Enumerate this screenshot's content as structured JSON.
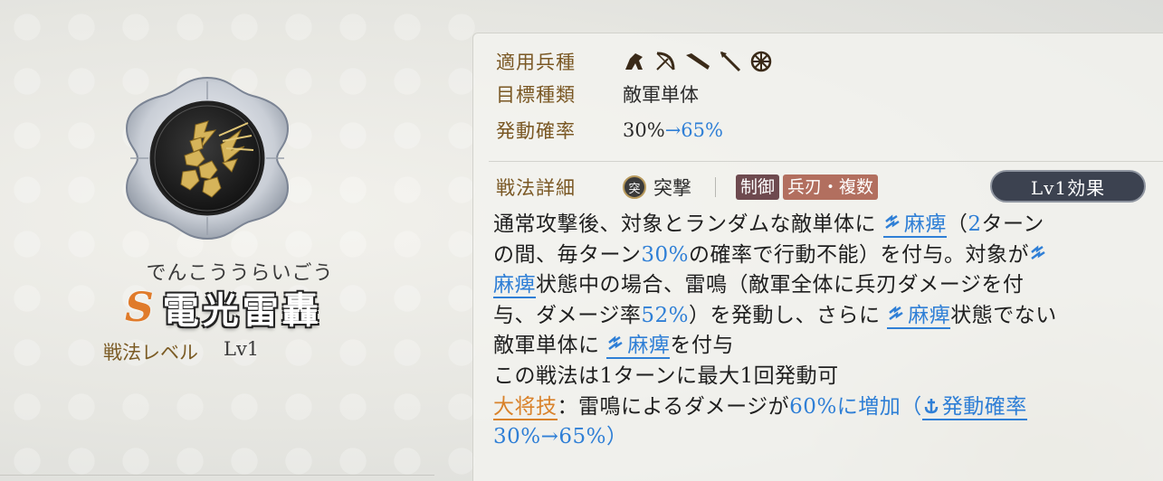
{
  "tactic": {
    "reading": "でんこううらいごう",
    "grade": "S",
    "name": "電光雷轟",
    "level_label": "戦法レベル",
    "level_value": "Lv1",
    "icon": "lightning-strike-emblem-icon"
  },
  "attributes": {
    "troop_label": "適用兵種",
    "troop_icons": [
      "cavalry-icon",
      "bow-icon",
      "gun-icon",
      "spear-icon",
      "wheel-icon"
    ],
    "target_label": "目標種類",
    "target_value": "敵軍単体",
    "rate_label": "発動確率",
    "rate_from": "30%",
    "rate_arrow": "→",
    "rate_to": "65%"
  },
  "detail": {
    "label": "戦法詳細",
    "type_icon_char": "突",
    "type_text": "突撃",
    "tags": [
      "制御",
      "兵刃・複数"
    ],
    "effect_button": "Lv1効果"
  },
  "description": {
    "l1_a": "通常攻撃後、対象とランダムな敵単体に",
    "l1_status": "麻痺",
    "l1_b": "（",
    "l1_num": "2",
    "l1_c": "ターン",
    "l2_a": "の間、毎ターン",
    "l2_num": "30%",
    "l2_b": "の確率で行動不能）を付与。対象が",
    "l3_status": "麻痺",
    "l3_a": "状態中の場合、雷鳴（敵軍全体に兵刃ダメージを付",
    "l4_a": "与、ダメージ率",
    "l4_num": "52%",
    "l4_b": "）を発動し、さらに",
    "l4_status": "麻痺",
    "l4_c": "状態でない",
    "l5_a": "敵軍単体に",
    "l5_status": "麻痺",
    "l5_b": "を付与",
    "l6": "この戦法は1ターンに最大1回発動可",
    "l7_general": "大将技",
    "l7_a": "：雷鳴によるダメージが",
    "l7_num": "60%",
    "l7_b": "に増加（",
    "l7_rate": "発動確率",
    "l8": "30%→65%）"
  },
  "colors": {
    "label_brown": "#7a5824",
    "link_blue": "#2f7fd6",
    "general_orange": "#d9822b",
    "grade_orange": "#e07b2b",
    "tag_control": "#6e4a4f",
    "tag_weapon": "#b26f5f",
    "button_bg": "#3c4250"
  }
}
